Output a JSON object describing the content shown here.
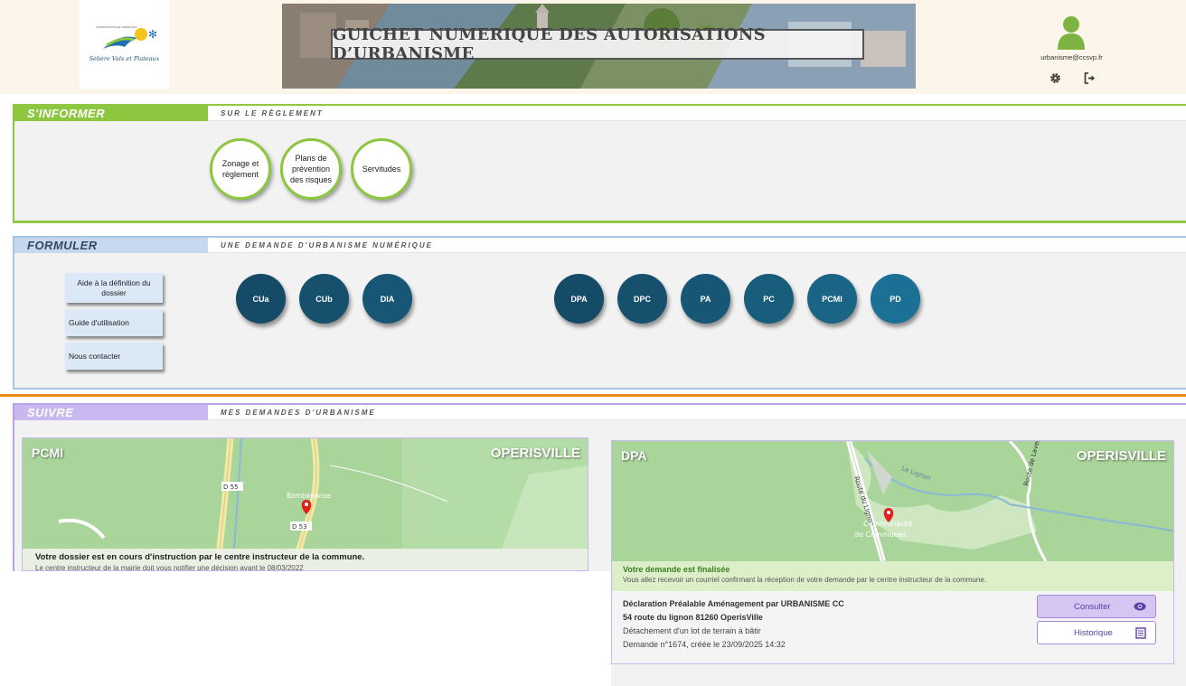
{
  "header": {
    "logo_tiny": "COMMUNAUTÉ DE COMMUNES",
    "logo_subtitle": "Sébère Vals et Plateaux",
    "banner_title": "GUICHET NUMERIQUE DES AUTORISATIONS D’URBANISME",
    "user_email": "urbanisme@ccsvp.fr"
  },
  "informer": {
    "tab": "S'INFORMER",
    "subtitle": "SUR LE RÈGLEMENT",
    "circles": [
      {
        "label": "Zonage et règlement"
      },
      {
        "label": "Plans de prévention des risques"
      },
      {
        "label": "Servitudes"
      }
    ]
  },
  "formuler": {
    "tab": "FORMULER",
    "subtitle": "UNE DEMANDE D'URBANISME NUMÉRIQUE",
    "side_buttons": [
      "Aide à la définition du dossier",
      "Guide d'utilisation",
      "Nous contacter"
    ],
    "circles": [
      "CUa",
      "CUb",
      "DIA",
      "DPA",
      "DPC",
      "PA",
      "PC",
      "PCMI",
      "PD"
    ]
  },
  "suivre": {
    "tab": "SUIVRE",
    "subtitle": "MES DEMANDES D'URBANISME",
    "card1": {
      "type": "PCMI",
      "city": "OPERISVILLE",
      "map_labels": {
        "road1": "D 55",
        "road2": "D 53",
        "place": "Bombepanse"
      },
      "status_title": "Votre dossier est en cours d'instruction par le centre instructeur de la commune.",
      "status_desc": "Le centre instructeur de la mairie doit vous notifier une décision avant le 08/03/2022"
    },
    "card2": {
      "type": "DPA",
      "city": "OPERISVILLE",
      "map_labels": {
        "road1": "Route du Lignon",
        "road2": "Route de Lavernède",
        "place1": "Communauté",
        "place2": "de Communes",
        "place3": "Le Lignon"
      },
      "status_title": "Votre demande est finalisée",
      "status_desc": "Vous allez recevoir un courriel confirmant la réception de votre demande par le centre instructeur de la commune.",
      "detail_title": "Déclaration Préalable Aménagement par URBANISME CC",
      "detail_address": "54 route du lignon 81260 OperisVille",
      "detail_desc": "Détachement d'un lot de terrain à bâtir",
      "detail_ref": "Demande n°1674, créée le 23/09/2025 14:32",
      "consult_label": "Consulter",
      "history_label": "Historique"
    }
  },
  "colors": {
    "informer": "#8dc63f",
    "formuler": "#c6d7ef",
    "suivre": "#c9b8f0",
    "circle_dark": "#154b66",
    "accent_orange": "#f0871a"
  },
  "icons": [
    "user-icon",
    "gear-icon",
    "logout-icon",
    "map-pin-icon",
    "eye-icon",
    "history-icon"
  ]
}
